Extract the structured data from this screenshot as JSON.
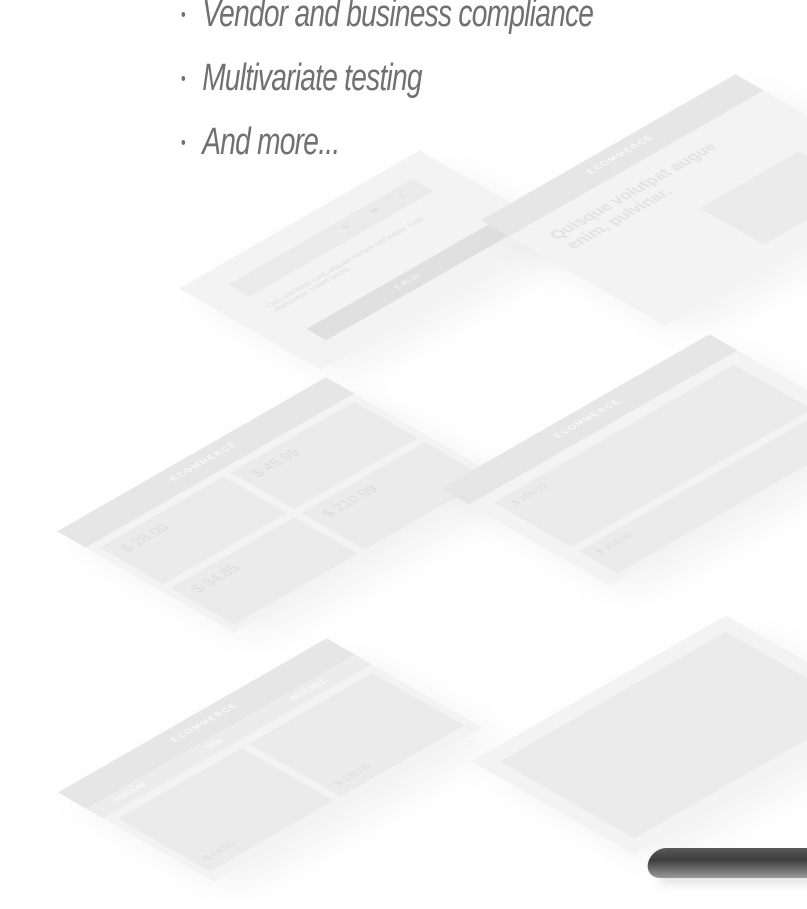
{
  "features": [
    "Vendor and business compliance",
    "Multivariate testing",
    "And more..."
  ],
  "screens": {
    "brand": "ECOMMERCE",
    "headline": "Quisque volutpat augue enim, pulvinar.",
    "size_options": [
      "S",
      "M",
      "L"
    ],
    "detail_desc": "Cras quis dolor nunc, aliquam tempor sed augue. Cras ullamcorper. Lorem ipsum.",
    "detail_price": "$ 45.00",
    "grid_prices": [
      "$ 28.00",
      "$ 45.99",
      "$ 34.85",
      "$ 210.99"
    ],
    "chair_prices": [
      "$ 199.99",
      "$ 255.00"
    ],
    "list_tabs": [
      "POPULAR",
      "NEW",
      "BEST SELL"
    ],
    "list_prices": [
      "$ 84.00",
      "$ 120.00"
    ]
  },
  "colors": {
    "bullet_text": "#707070",
    "card_bg": "#f3f3f3"
  }
}
